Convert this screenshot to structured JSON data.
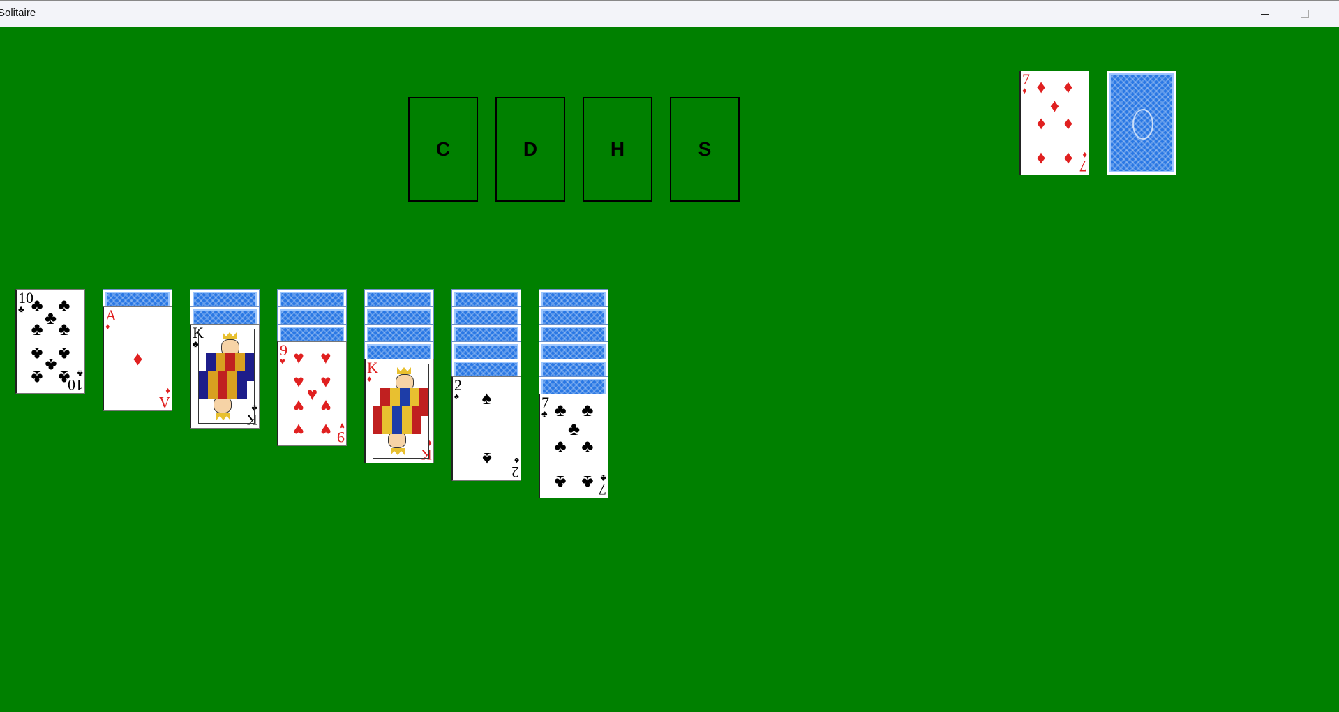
{
  "window": {
    "title": "Solitaire"
  },
  "foundations": [
    {
      "label": "C"
    },
    {
      "label": "D"
    },
    {
      "label": "H"
    },
    {
      "label": "S"
    }
  ],
  "waste": {
    "rank": "7",
    "suit": "diamonds",
    "suit_glyph": "♦"
  },
  "stock": {
    "state": "face-down"
  },
  "tableau": [
    {
      "hidden": 0,
      "top": {
        "rank": "10",
        "suit": "clubs",
        "suit_glyph": "♣"
      }
    },
    {
      "hidden": 1,
      "top": {
        "rank": "A",
        "suit": "diamonds",
        "suit_glyph": "♦"
      }
    },
    {
      "hidden": 2,
      "top": {
        "rank": "K",
        "suit": "clubs",
        "suit_glyph": "♣"
      }
    },
    {
      "hidden": 3,
      "top": {
        "rank": "9",
        "suit": "hearts",
        "suit_glyph": "♥"
      }
    },
    {
      "hidden": 4,
      "top": {
        "rank": "K",
        "suit": "diamonds",
        "suit_glyph": "♦"
      }
    },
    {
      "hidden": 5,
      "top": {
        "rank": "2",
        "suit": "spades",
        "suit_glyph": "♠"
      }
    },
    {
      "hidden": 6,
      "top": {
        "rank": "7",
        "suit": "clubs",
        "suit_glyph": "♣"
      }
    }
  ],
  "colors": {
    "table": "#008000",
    "red_suit": "#e02020",
    "black_suit": "#000000",
    "card_back": "#2a78e4"
  }
}
